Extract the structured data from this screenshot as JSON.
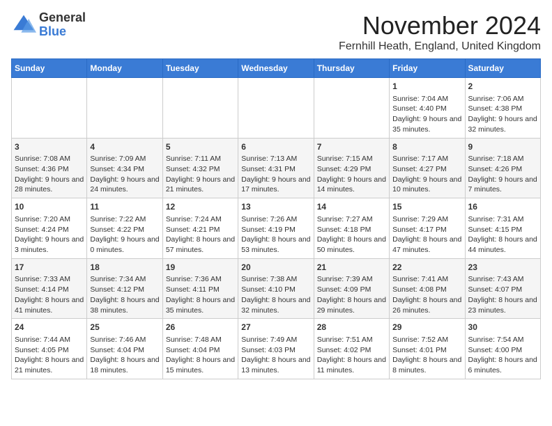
{
  "header": {
    "logo_general": "General",
    "logo_blue": "Blue",
    "month_title": "November 2024",
    "location": "Fernhill Heath, England, United Kingdom"
  },
  "days_of_week": [
    "Sunday",
    "Monday",
    "Tuesday",
    "Wednesday",
    "Thursday",
    "Friday",
    "Saturday"
  ],
  "weeks": [
    [
      {
        "day": "",
        "info": ""
      },
      {
        "day": "",
        "info": ""
      },
      {
        "day": "",
        "info": ""
      },
      {
        "day": "",
        "info": ""
      },
      {
        "day": "",
        "info": ""
      },
      {
        "day": "1",
        "info": "Sunrise: 7:04 AM\nSunset: 4:40 PM\nDaylight: 9 hours and 35 minutes."
      },
      {
        "day": "2",
        "info": "Sunrise: 7:06 AM\nSunset: 4:38 PM\nDaylight: 9 hours and 32 minutes."
      }
    ],
    [
      {
        "day": "3",
        "info": "Sunrise: 7:08 AM\nSunset: 4:36 PM\nDaylight: 9 hours and 28 minutes."
      },
      {
        "day": "4",
        "info": "Sunrise: 7:09 AM\nSunset: 4:34 PM\nDaylight: 9 hours and 24 minutes."
      },
      {
        "day": "5",
        "info": "Sunrise: 7:11 AM\nSunset: 4:32 PM\nDaylight: 9 hours and 21 minutes."
      },
      {
        "day": "6",
        "info": "Sunrise: 7:13 AM\nSunset: 4:31 PM\nDaylight: 9 hours and 17 minutes."
      },
      {
        "day": "7",
        "info": "Sunrise: 7:15 AM\nSunset: 4:29 PM\nDaylight: 9 hours and 14 minutes."
      },
      {
        "day": "8",
        "info": "Sunrise: 7:17 AM\nSunset: 4:27 PM\nDaylight: 9 hours and 10 minutes."
      },
      {
        "day": "9",
        "info": "Sunrise: 7:18 AM\nSunset: 4:26 PM\nDaylight: 9 hours and 7 minutes."
      }
    ],
    [
      {
        "day": "10",
        "info": "Sunrise: 7:20 AM\nSunset: 4:24 PM\nDaylight: 9 hours and 3 minutes."
      },
      {
        "day": "11",
        "info": "Sunrise: 7:22 AM\nSunset: 4:22 PM\nDaylight: 9 hours and 0 minutes."
      },
      {
        "day": "12",
        "info": "Sunrise: 7:24 AM\nSunset: 4:21 PM\nDaylight: 8 hours and 57 minutes."
      },
      {
        "day": "13",
        "info": "Sunrise: 7:26 AM\nSunset: 4:19 PM\nDaylight: 8 hours and 53 minutes."
      },
      {
        "day": "14",
        "info": "Sunrise: 7:27 AM\nSunset: 4:18 PM\nDaylight: 8 hours and 50 minutes."
      },
      {
        "day": "15",
        "info": "Sunrise: 7:29 AM\nSunset: 4:17 PM\nDaylight: 8 hours and 47 minutes."
      },
      {
        "day": "16",
        "info": "Sunrise: 7:31 AM\nSunset: 4:15 PM\nDaylight: 8 hours and 44 minutes."
      }
    ],
    [
      {
        "day": "17",
        "info": "Sunrise: 7:33 AM\nSunset: 4:14 PM\nDaylight: 8 hours and 41 minutes."
      },
      {
        "day": "18",
        "info": "Sunrise: 7:34 AM\nSunset: 4:12 PM\nDaylight: 8 hours and 38 minutes."
      },
      {
        "day": "19",
        "info": "Sunrise: 7:36 AM\nSunset: 4:11 PM\nDaylight: 8 hours and 35 minutes."
      },
      {
        "day": "20",
        "info": "Sunrise: 7:38 AM\nSunset: 4:10 PM\nDaylight: 8 hours and 32 minutes."
      },
      {
        "day": "21",
        "info": "Sunrise: 7:39 AM\nSunset: 4:09 PM\nDaylight: 8 hours and 29 minutes."
      },
      {
        "day": "22",
        "info": "Sunrise: 7:41 AM\nSunset: 4:08 PM\nDaylight: 8 hours and 26 minutes."
      },
      {
        "day": "23",
        "info": "Sunrise: 7:43 AM\nSunset: 4:07 PM\nDaylight: 8 hours and 23 minutes."
      }
    ],
    [
      {
        "day": "24",
        "info": "Sunrise: 7:44 AM\nSunset: 4:05 PM\nDaylight: 8 hours and 21 minutes."
      },
      {
        "day": "25",
        "info": "Sunrise: 7:46 AM\nSunset: 4:04 PM\nDaylight: 8 hours and 18 minutes."
      },
      {
        "day": "26",
        "info": "Sunrise: 7:48 AM\nSunset: 4:04 PM\nDaylight: 8 hours and 15 minutes."
      },
      {
        "day": "27",
        "info": "Sunrise: 7:49 AM\nSunset: 4:03 PM\nDaylight: 8 hours and 13 minutes."
      },
      {
        "day": "28",
        "info": "Sunrise: 7:51 AM\nSunset: 4:02 PM\nDaylight: 8 hours and 11 minutes."
      },
      {
        "day": "29",
        "info": "Sunrise: 7:52 AM\nSunset: 4:01 PM\nDaylight: 8 hours and 8 minutes."
      },
      {
        "day": "30",
        "info": "Sunrise: 7:54 AM\nSunset: 4:00 PM\nDaylight: 8 hours and 6 minutes."
      }
    ]
  ]
}
